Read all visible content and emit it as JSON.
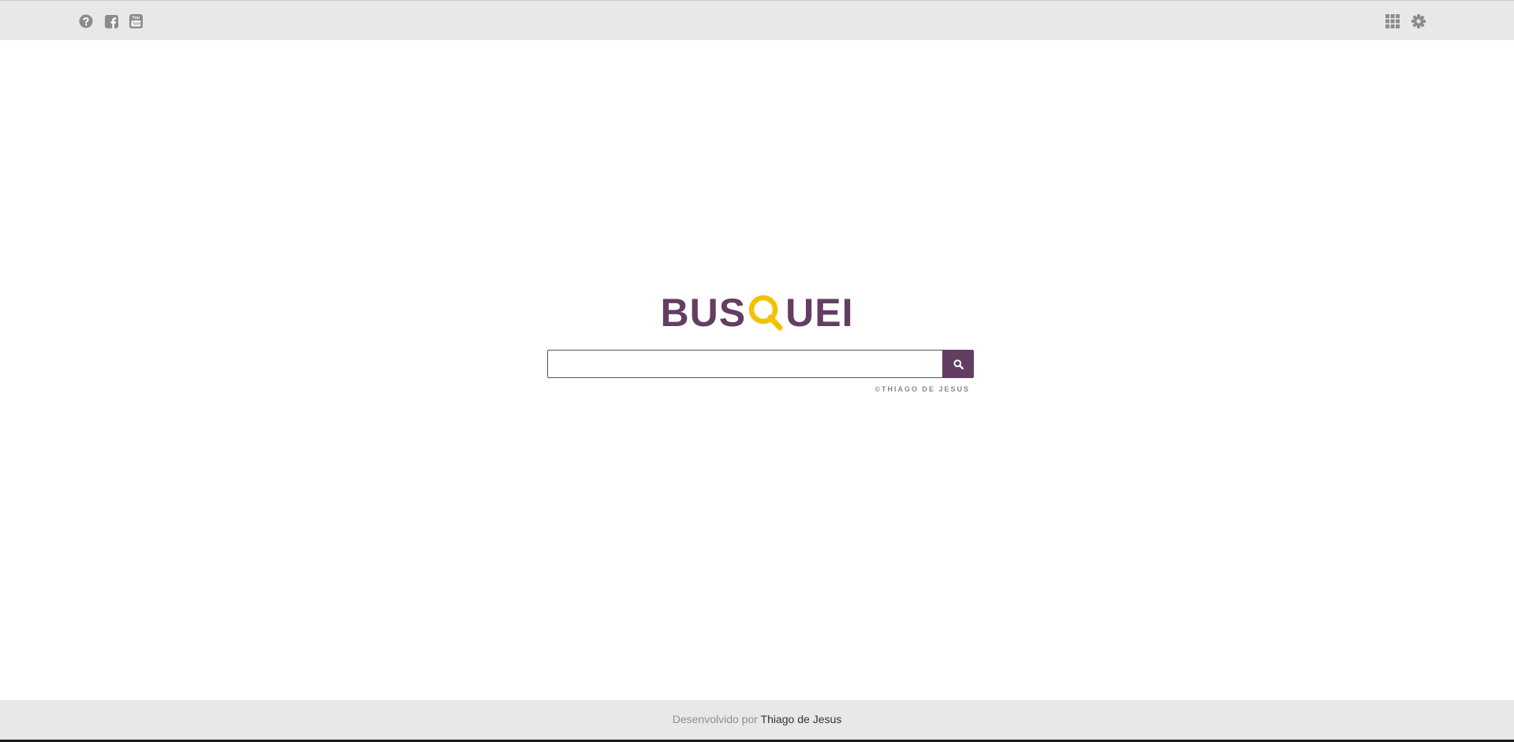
{
  "header": {
    "left_icons": [
      "help-icon",
      "facebook-icon",
      "youtube-icon"
    ],
    "right_icons": [
      "apps-grid-icon",
      "gear-icon"
    ],
    "icon_color": "#8c8c8c"
  },
  "logo": {
    "part1": "BUS",
    "part2": "UEI",
    "q_icon": "magnifier-q-icon",
    "color": "#633e63",
    "accent_color": "#f2c200"
  },
  "search": {
    "value": "",
    "placeholder": "",
    "button_icon": "search-icon"
  },
  "copyright": "©THIAGO DE JESUS",
  "footer": {
    "prefix": "Desenvolvido por",
    "author": "Thiago de Jesus"
  }
}
